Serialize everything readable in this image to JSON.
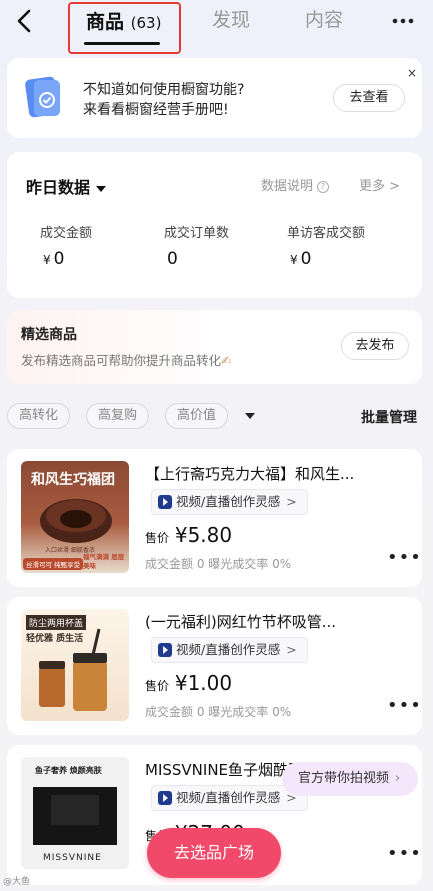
{
  "nav": {
    "tab_goods_label": "商品",
    "tab_goods_count": "(63)",
    "tab_find_label": "发现",
    "tab_content_label": "内容"
  },
  "guide": {
    "line1": "不知道如何使用橱窗功能?",
    "line2": "来看看橱窗经营手册吧!",
    "button": "去查看",
    "close": "×"
  },
  "stats": {
    "title": "昨日数据",
    "help": "数据说明",
    "more": "更多 >",
    "items": [
      {
        "label": "成交金额",
        "prefix": "¥",
        "value": "0"
      },
      {
        "label": "成交订单数",
        "prefix": "",
        "value": "0"
      },
      {
        "label": "单访客成交额",
        "prefix": "¥",
        "value": "0"
      }
    ]
  },
  "featured": {
    "title": "精选商品",
    "subtitle": "发布精选商品可帮助你提升商品转化",
    "button": "去发布"
  },
  "filters": {
    "chips": [
      "高转化",
      "高复购",
      "高价值"
    ],
    "batch": "批量管理"
  },
  "products": [
    {
      "title": "【上行斋巧克力大福】和风生...",
      "tag": "视频/直播创作灵感",
      "price_label": "售价",
      "price": "¥5.80",
      "metrics": "成交金额 0  曝光成交率 0%",
      "image_texts": [
        "和风生巧福团",
        "入口丝滑 细腻香浓",
        "丝滑可可 纯甄享受",
        "福气满满 层层美味"
      ]
    },
    {
      "title": "(一元福利)网红竹节杯吸管...",
      "tag": "视频/直播创作灵感",
      "price_label": "售价",
      "price": "¥1.00",
      "metrics": "成交金额 0  曝光成交率 0%",
      "image_texts": [
        "防尘两用杯盖",
        "轻优雅 质生活"
      ]
    },
    {
      "title": "MISSVNINE鱼子烟酰胺...",
      "tag": "视频/直播创作灵感",
      "price_label": "售价",
      "price": "¥27.00",
      "metrics": "",
      "image_texts": [
        "鱼子奢养 焕颜亮肤",
        "MISSVNINE"
      ]
    }
  ],
  "floating": {
    "video_pill": "官方带你拍视频",
    "square_button": "去选品广场"
  },
  "watermark": "@大鱼"
}
